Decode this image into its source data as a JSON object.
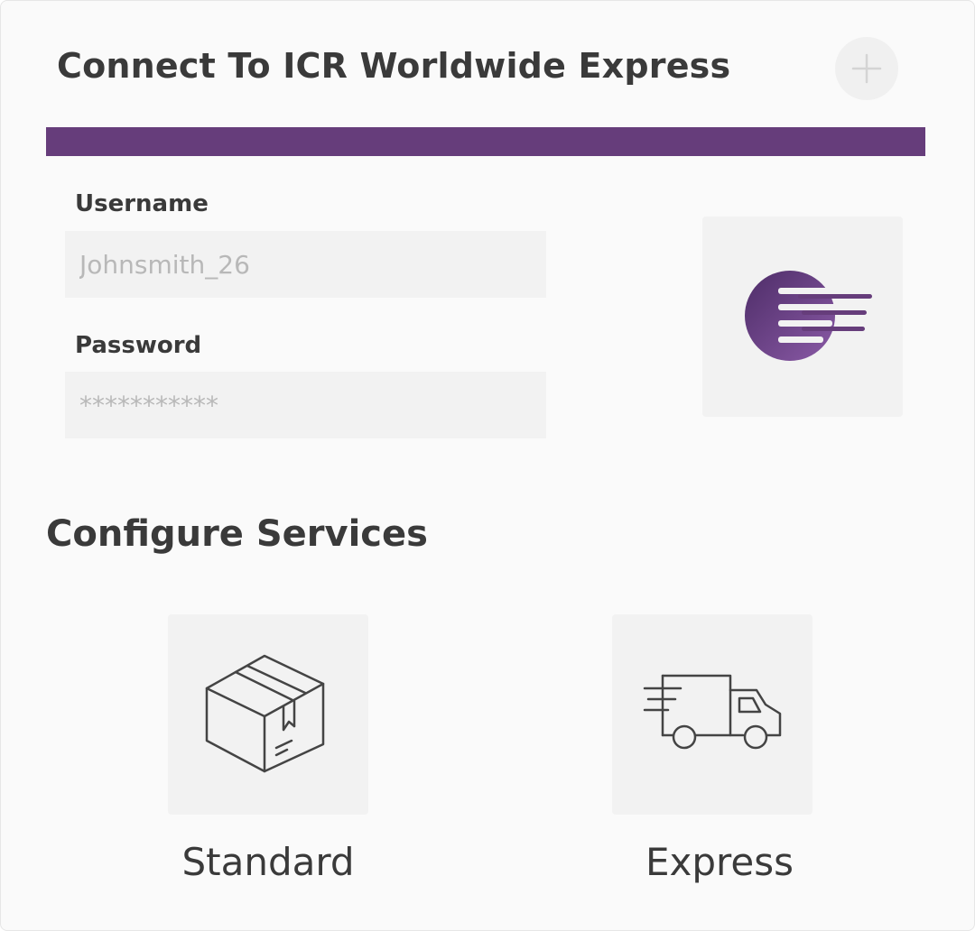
{
  "header": {
    "title": "Connect To ICR Worldwide Express",
    "add_icon": "plus-icon"
  },
  "colors": {
    "accent": "#663d7b",
    "text": "#3a3a3a",
    "field_bg": "#f2f2f2",
    "placeholder": "#b8b8b8"
  },
  "form": {
    "username": {
      "label": "Username",
      "value": "",
      "placeholder": "Johnsmith_26"
    },
    "password": {
      "label": "Password",
      "value": "",
      "placeholder": "***********"
    }
  },
  "logo": {
    "icon": "icr-logo-icon"
  },
  "services": {
    "title": "Configure Services",
    "items": [
      {
        "label": "Standard",
        "icon": "package-box-icon"
      },
      {
        "label": "Express",
        "icon": "delivery-truck-icon"
      }
    ]
  }
}
